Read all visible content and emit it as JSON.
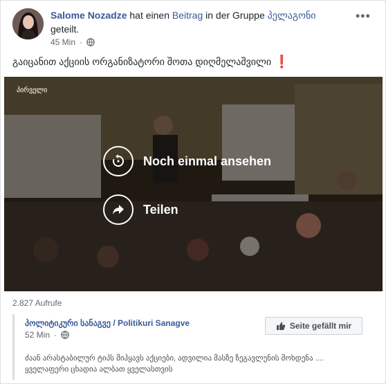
{
  "post": {
    "author": "Salome Nozadze",
    "action_pre": "hat einen",
    "action_link": "Beitrag",
    "action_mid": "in der Gruppe",
    "group_name": "პელაგონი",
    "action_post": "geteilt.",
    "time": "45 Min",
    "privacy_icon": "globe-icon",
    "more_icon": "more-options-icon",
    "text": "გაიცანით აქციის ორგანიზატორი შოთა დიღმელაშვილი",
    "emoji": "❗"
  },
  "video": {
    "watermark": "პირველი",
    "replay_label": "Noch einmal ansehen",
    "share_label": "Teilen"
  },
  "stats": {
    "views": "2.827 Aufrufe"
  },
  "shared": {
    "page_name": "პოლიტიკური სანაგვე / Politikuri Sanagve",
    "time": "52 Min",
    "like_label": "Seite gefällt mir",
    "text_line1": "ძაან არასტაბილურ ტიპს მიჰყავს აქციები, ადვილია მასზე ზეგავლენის მოხდენა ....",
    "text_line2": "ყველაფერი ცხადია ალბათ ყველასთვის"
  },
  "colors": {
    "link": "#385898",
    "meta": "#606770",
    "text": "#1d2129"
  }
}
